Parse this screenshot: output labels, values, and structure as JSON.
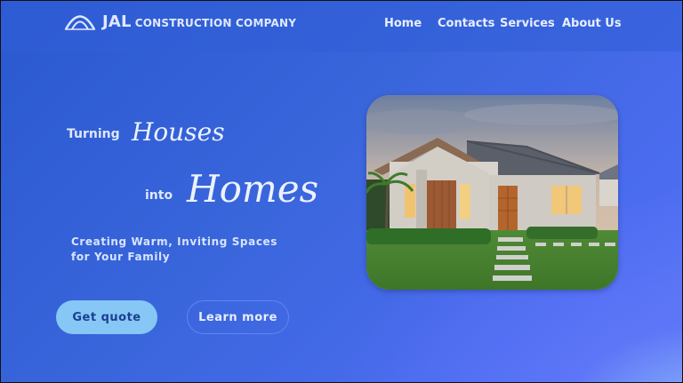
{
  "header": {
    "brand_main": "JAL",
    "brand_sub": "CONSTRUCTION COMPANY",
    "logo_icon": "roof-arch-logo-icon"
  },
  "nav": {
    "items": [
      {
        "label": "Home"
      },
      {
        "label": "Contacts"
      },
      {
        "label": "Services"
      },
      {
        "label": "About Us"
      }
    ]
  },
  "hero": {
    "word1": "Turning",
    "script1": "Houses",
    "word2": "into",
    "script2": "Homes",
    "tagline": "Creating Warm, Inviting Spaces for Your Family",
    "image_icon": "modern-house-photo"
  },
  "buttons": {
    "quote": "Get quote",
    "learn": "Learn more"
  },
  "colors": {
    "background_start": "#2a58cf",
    "background_end": "#5878f5",
    "primary_button": "#86c7f6",
    "primary_button_text": "#1c3f90",
    "text_light": "#dfe8ff"
  }
}
